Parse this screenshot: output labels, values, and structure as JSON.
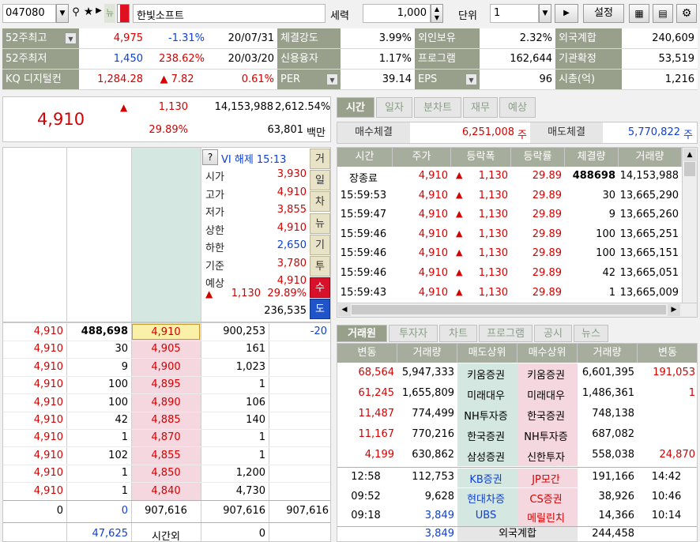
{
  "toolbar": {
    "code": "047080",
    "name": "한빛소프트",
    "qty_label": "세력",
    "qty": "1,000",
    "unit_label": "단위",
    "unit": "1",
    "settings": "설정",
    "news_badge": "뉴"
  },
  "stats": [
    [
      "52주최고",
      "4,975",
      "-1.31%",
      "20/07/31",
      "체결강도",
      "3.99%",
      "외인보유",
      "2.32%",
      "외국계합",
      "240,609"
    ],
    [
      "52주최저",
      "1,450",
      "238.62%",
      "20/03/20",
      "신용융자",
      "1.17%",
      "프로그램",
      "162,644",
      "기관확정",
      "53,519"
    ],
    [
      "KQ 디지털컨",
      "1,284.28",
      "▲ 7.82",
      "0.61%",
      "PER",
      "39.14",
      "EPS",
      "96",
      "시총(억)",
      "1,216"
    ]
  ],
  "summary": {
    "price": "4,910",
    "change": "1,130",
    "rate": "29.89%",
    "volume": "14,153,988",
    "vol_rate": "2,612.54%",
    "amount": "63,801",
    "amount_unit": "백만"
  },
  "info": {
    "q": "?",
    "vi": "VI 해제 15:13",
    "rows": [
      [
        "시가",
        "3,930"
      ],
      [
        "고가",
        "4,910"
      ],
      [
        "저가",
        "3,855"
      ],
      [
        "상한",
        "4,910"
      ],
      [
        "하한",
        "2,650"
      ],
      [
        "기준",
        "3,780"
      ],
      [
        "예상",
        "4,910"
      ]
    ],
    "exp_change": "1,130",
    "exp_rate": "29.89%",
    "exp_vol": "236,535"
  },
  "side_tabs": [
    "거",
    "일",
    "차",
    "뉴",
    "기",
    "투",
    "수",
    "도"
  ],
  "ask_sum": "-20",
  "orderbook": [
    [
      "4,910",
      "488,698",
      "4,910",
      "900,253"
    ],
    [
      "4,910",
      "30",
      "4,905",
      "161"
    ],
    [
      "4,910",
      "9",
      "4,900",
      "1,023"
    ],
    [
      "4,910",
      "100",
      "4,895",
      "1"
    ],
    [
      "4,910",
      "100",
      "4,890",
      "106"
    ],
    [
      "4,910",
      "42",
      "4,885",
      "140"
    ],
    [
      "4,910",
      "1",
      "4,870",
      "1"
    ],
    [
      "4,910",
      "102",
      "4,855",
      "1"
    ],
    [
      "4,910",
      "1",
      "4,850",
      "1,200"
    ],
    [
      "4,910",
      "1",
      "4,840",
      "4,730"
    ]
  ],
  "ob_total": [
    "0",
    "0",
    "907,616",
    "907,616",
    "907,616"
  ],
  "ob_foot": [
    "47,625",
    "시간외",
    "0"
  ],
  "tabs_top": [
    "시간",
    "일자",
    "분차트",
    "재무",
    "예상"
  ],
  "buy_label": "매수체결",
  "buy_val": "6,251,008",
  "buy_unit": "주",
  "sell_label": "매도체결",
  "sell_val": "5,770,822",
  "sell_unit": "주",
  "trade_headers": [
    "시간",
    "주가",
    "등락폭",
    "등락률",
    "체결량",
    "거래량"
  ],
  "trades": [
    [
      "장종료",
      "4,910",
      "1,130",
      "29.89",
      "488698",
      "14,153,988"
    ],
    [
      "15:59:53",
      "4,910",
      "1,130",
      "29.89",
      "30",
      "13,665,290"
    ],
    [
      "15:59:47",
      "4,910",
      "1,130",
      "29.89",
      "9",
      "13,665,260"
    ],
    [
      "15:59:46",
      "4,910",
      "1,130",
      "29.89",
      "100",
      "13,665,251"
    ],
    [
      "15:59:46",
      "4,910",
      "1,130",
      "29.89",
      "100",
      "13,665,151"
    ],
    [
      "15:59:46",
      "4,910",
      "1,130",
      "29.89",
      "42",
      "13,665,051"
    ],
    [
      "15:59:43",
      "4,910",
      "1,130",
      "29.89",
      "1",
      "13,665,009"
    ]
  ],
  "tabs_bottom": [
    "거래원",
    "투자자",
    "차트",
    "프로그램",
    "공시",
    "뉴스"
  ],
  "broker_headers": [
    "변동",
    "거래량",
    "매도상위",
    "매수상위",
    "거래량",
    "변동"
  ],
  "brokers": [
    [
      "68,564",
      "5,947,333",
      "키움증권",
      "키움증권",
      "6,601,395",
      "191,053"
    ],
    [
      "61,245",
      "1,655,809",
      "미래대우",
      "미래대우",
      "1,486,361",
      "1"
    ],
    [
      "11,487",
      "774,499",
      "NH투자증",
      "한국증권",
      "748,138",
      ""
    ],
    [
      "11,167",
      "770,216",
      "한국증권",
      "NH투자증",
      "687,082",
      ""
    ],
    [
      "4,199",
      "630,862",
      "삼성증권",
      "신한투자",
      "558,038",
      "24,870"
    ]
  ],
  "foreign_rows": [
    [
      "12:58",
      "112,753",
      "KB증권",
      "JP모간",
      "191,166",
      "14:42"
    ],
    [
      "09:52",
      "9,628",
      "현대차증",
      "CS증권",
      "38,926",
      "10:46"
    ],
    [
      "09:18",
      "3,849",
      "UBS",
      "메릴린치",
      "14,366",
      "10:14"
    ]
  ],
  "foreign_total": [
    "3,849",
    "외국계합",
    "244,458"
  ]
}
